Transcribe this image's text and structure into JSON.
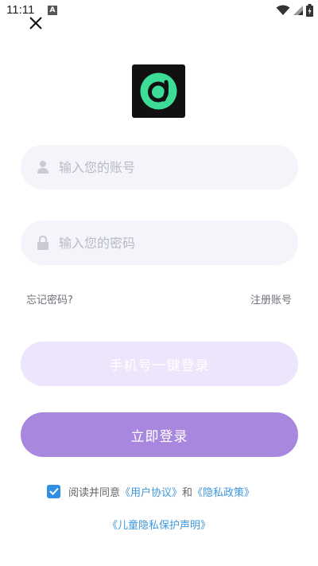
{
  "status": {
    "time": "11:11",
    "notification_letter": "A",
    "icons": [
      "wifi-icon",
      "signal-icon",
      "battery-icon"
    ]
  },
  "close_icon": "close-icon",
  "logo_icon": "app-logo",
  "account": {
    "placeholder": "输入您的账号",
    "icon": "user-icon"
  },
  "password": {
    "placeholder": "输入您的密码",
    "icon": "lock-icon"
  },
  "links": {
    "forgot": "忘记密码?",
    "register": "注册账号"
  },
  "buttons": {
    "phone_login": "手机号一键登录",
    "login": "立即登录"
  },
  "agreement": {
    "prefix": "阅读并同意",
    "user_agreement": "《用户协议》",
    "and": "和",
    "privacy_policy": "《隐私政策》",
    "children_privacy": "《儿童隐私保护声明》",
    "checked": true
  },
  "colors": {
    "primary": "#a888df",
    "phone_button": "#ece5fb",
    "link": "#3e97dc",
    "checkbox": "#2f8fe4",
    "logo_accent": "#3ddc97"
  }
}
